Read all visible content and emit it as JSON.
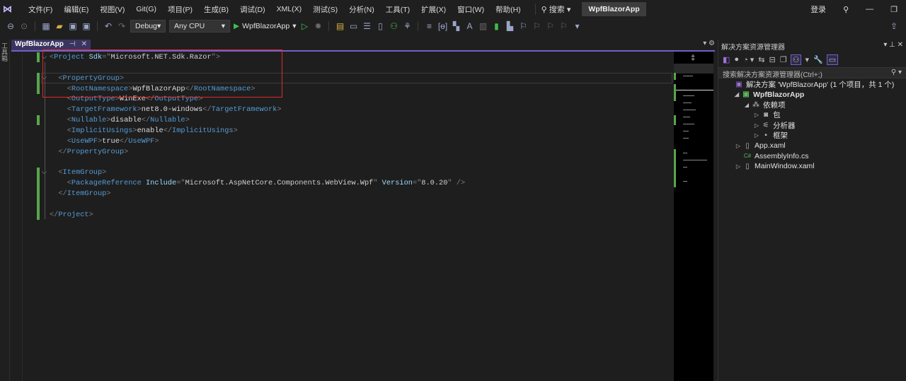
{
  "menubar": {
    "items": [
      "文件(F)",
      "编辑(E)",
      "视图(V)",
      "Git(G)",
      "项目(P)",
      "生成(B)",
      "调试(D)",
      "XML(X)",
      "测试(S)",
      "分析(N)",
      "工具(T)",
      "扩展(X)",
      "窗口(W)",
      "帮助(H)"
    ],
    "search": "搜索",
    "app_title": "WpfBlazorApp",
    "login": "登录"
  },
  "toolbar": {
    "config": "Debug",
    "platform": "Any CPU",
    "run_target": "WpfBlazorApp"
  },
  "left_strip": "工具箱",
  "tab": {
    "label": "WpfBlazorApp"
  },
  "code": [
    [
      [
        "b",
        "<"
      ],
      [
        "t",
        "Project"
      ],
      [
        "x",
        " "
      ],
      [
        "a",
        "Sdk"
      ],
      [
        "b",
        "=\""
      ],
      [
        "v",
        "Microsoft.NET.Sdk.Razor"
      ],
      [
        "b",
        "\">"
      ]
    ],
    [],
    [
      [
        "x",
        "  "
      ],
      [
        "b",
        "<"
      ],
      [
        "t",
        "PropertyGroup"
      ],
      [
        "b",
        ">"
      ]
    ],
    [
      [
        "x",
        "    "
      ],
      [
        "b",
        "<"
      ],
      [
        "t",
        "RootNamespace"
      ],
      [
        "b",
        ">"
      ],
      [
        "x",
        "WpfBlazorApp"
      ],
      [
        "b",
        "</"
      ],
      [
        "t",
        "RootNamespace"
      ],
      [
        "b",
        ">"
      ]
    ],
    [
      [
        "x",
        "    "
      ],
      [
        "b",
        "<"
      ],
      [
        "t",
        "OutputType"
      ],
      [
        "b",
        ">"
      ],
      [
        "x",
        "WinExe"
      ],
      [
        "b",
        "</"
      ],
      [
        "t",
        "OutputType"
      ],
      [
        "b",
        ">"
      ]
    ],
    [
      [
        "x",
        "    "
      ],
      [
        "b",
        "<"
      ],
      [
        "t",
        "TargetFramework"
      ],
      [
        "b",
        ">"
      ],
      [
        "x",
        "net8.0-windows"
      ],
      [
        "b",
        "</"
      ],
      [
        "t",
        "TargetFramework"
      ],
      [
        "b",
        ">"
      ]
    ],
    [
      [
        "x",
        "    "
      ],
      [
        "b",
        "<"
      ],
      [
        "t",
        "Nullable"
      ],
      [
        "b",
        ">"
      ],
      [
        "x",
        "disable"
      ],
      [
        "b",
        "</"
      ],
      [
        "t",
        "Nullable"
      ],
      [
        "b",
        ">"
      ]
    ],
    [
      [
        "x",
        "    "
      ],
      [
        "b",
        "<"
      ],
      [
        "t",
        "ImplicitUsings"
      ],
      [
        "b",
        ">"
      ],
      [
        "x",
        "enable"
      ],
      [
        "b",
        "</"
      ],
      [
        "t",
        "ImplicitUsings"
      ],
      [
        "b",
        ">"
      ]
    ],
    [
      [
        "x",
        "    "
      ],
      [
        "b",
        "<"
      ],
      [
        "t",
        "UseWPF"
      ],
      [
        "b",
        ">"
      ],
      [
        "x",
        "true"
      ],
      [
        "b",
        "</"
      ],
      [
        "t",
        "UseWPF"
      ],
      [
        "b",
        ">"
      ]
    ],
    [
      [
        "x",
        "  "
      ],
      [
        "b",
        "</"
      ],
      [
        "t",
        "PropertyGroup"
      ],
      [
        "b",
        ">"
      ]
    ],
    [],
    [
      [
        "x",
        "  "
      ],
      [
        "b",
        "<"
      ],
      [
        "t",
        "ItemGroup"
      ],
      [
        "b",
        ">"
      ]
    ],
    [
      [
        "x",
        "    "
      ],
      [
        "b",
        "<"
      ],
      [
        "t",
        "PackageReference"
      ],
      [
        "x",
        " "
      ],
      [
        "a",
        "Include"
      ],
      [
        "b",
        "=\""
      ],
      [
        "v",
        "Microsoft.AspNetCore.Components.WebView.Wpf"
      ],
      [
        "b",
        "\""
      ],
      [
        "x",
        " "
      ],
      [
        "a",
        "Version"
      ],
      [
        "b",
        "=\""
      ],
      [
        "v",
        "8.0.20"
      ],
      [
        "b",
        "\""
      ],
      [
        "x",
        " "
      ],
      [
        "b",
        "/>"
      ]
    ],
    [
      [
        "x",
        "  "
      ],
      [
        "b",
        "</"
      ],
      [
        "t",
        "ItemGroup"
      ],
      [
        "b",
        ">"
      ]
    ],
    [],
    [
      [
        "b",
        "</"
      ],
      [
        "t",
        "Project"
      ],
      [
        "b",
        ">"
      ]
    ]
  ],
  "solution_explorer": {
    "title": "解决方案资源管理器",
    "search_placeholder": "搜索解决方案资源管理器(Ctrl+;)",
    "nodes": [
      {
        "label": "解决方案 'WpfBlazorApp' (1 个项目，共 1 个)",
        "icon": "solution-icon",
        "arrow": ""
      },
      {
        "label": "WpfBlazorApp",
        "icon": "csproj-icon",
        "arrow": "◢"
      },
      {
        "label": "依赖项",
        "icon": "dependencies-icon",
        "arrow": "◢"
      },
      {
        "label": "包",
        "icon": "package-icon",
        "arrow": "▷"
      },
      {
        "label": "分析器",
        "icon": "analyzer-icon",
        "arrow": "▷"
      },
      {
        "label": "框架",
        "icon": "framework-icon",
        "arrow": "▷"
      },
      {
        "label": "App.xaml",
        "icon": "xaml-file-icon",
        "arrow": "▷"
      },
      {
        "label": "AssemblyInfo.cs",
        "icon": "csharp-file-icon",
        "arrow": ""
      },
      {
        "label": "MainWindow.xaml",
        "icon": "xaml-file-icon",
        "arrow": "▷"
      }
    ]
  }
}
